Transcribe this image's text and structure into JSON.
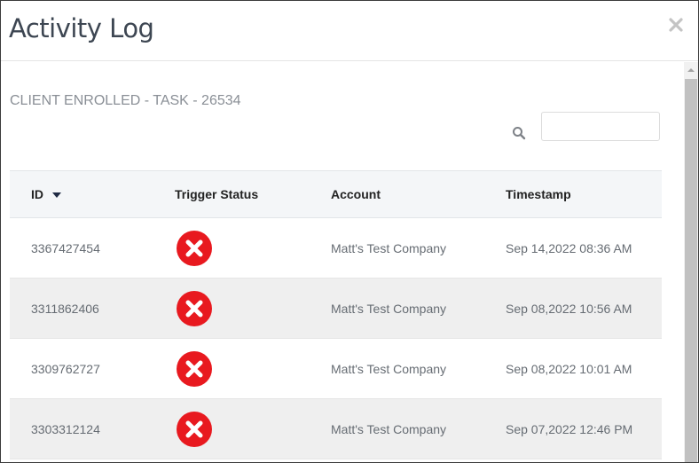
{
  "modal": {
    "title": "Activity Log",
    "subtitle": "CLIENT ENROLLED - TASK - 26534"
  },
  "search": {
    "placeholder": "",
    "value": ""
  },
  "table": {
    "columns": [
      {
        "label": "ID",
        "sorted": "descending"
      },
      {
        "label": "Trigger Status"
      },
      {
        "label": "Account"
      },
      {
        "label": "Timestamp"
      }
    ],
    "rows": [
      {
        "id": "3367427454",
        "status": "failed",
        "account": "Matt's Test Company",
        "timestamp": "Sep 14,2022 08:36 AM"
      },
      {
        "id": "3311862406",
        "status": "failed",
        "account": "Matt's Test Company",
        "timestamp": "Sep 08,2022 10:56 AM"
      },
      {
        "id": "3309762727",
        "status": "failed",
        "account": "Matt's Test Company",
        "timestamp": "Sep 08,2022 10:01 AM"
      },
      {
        "id": "3303312124",
        "status": "failed",
        "account": "Matt's Test Company",
        "timestamp": "Sep 07,2022 12:46 PM"
      }
    ]
  },
  "colors": {
    "error": "#e8191f",
    "row_alt": "#efefef",
    "header_bg": "#f4f6f8"
  },
  "icons": {
    "close": "close-icon",
    "search": "search-icon",
    "status_failed": "error-circle-icon",
    "sort": "sort-down-icon"
  }
}
